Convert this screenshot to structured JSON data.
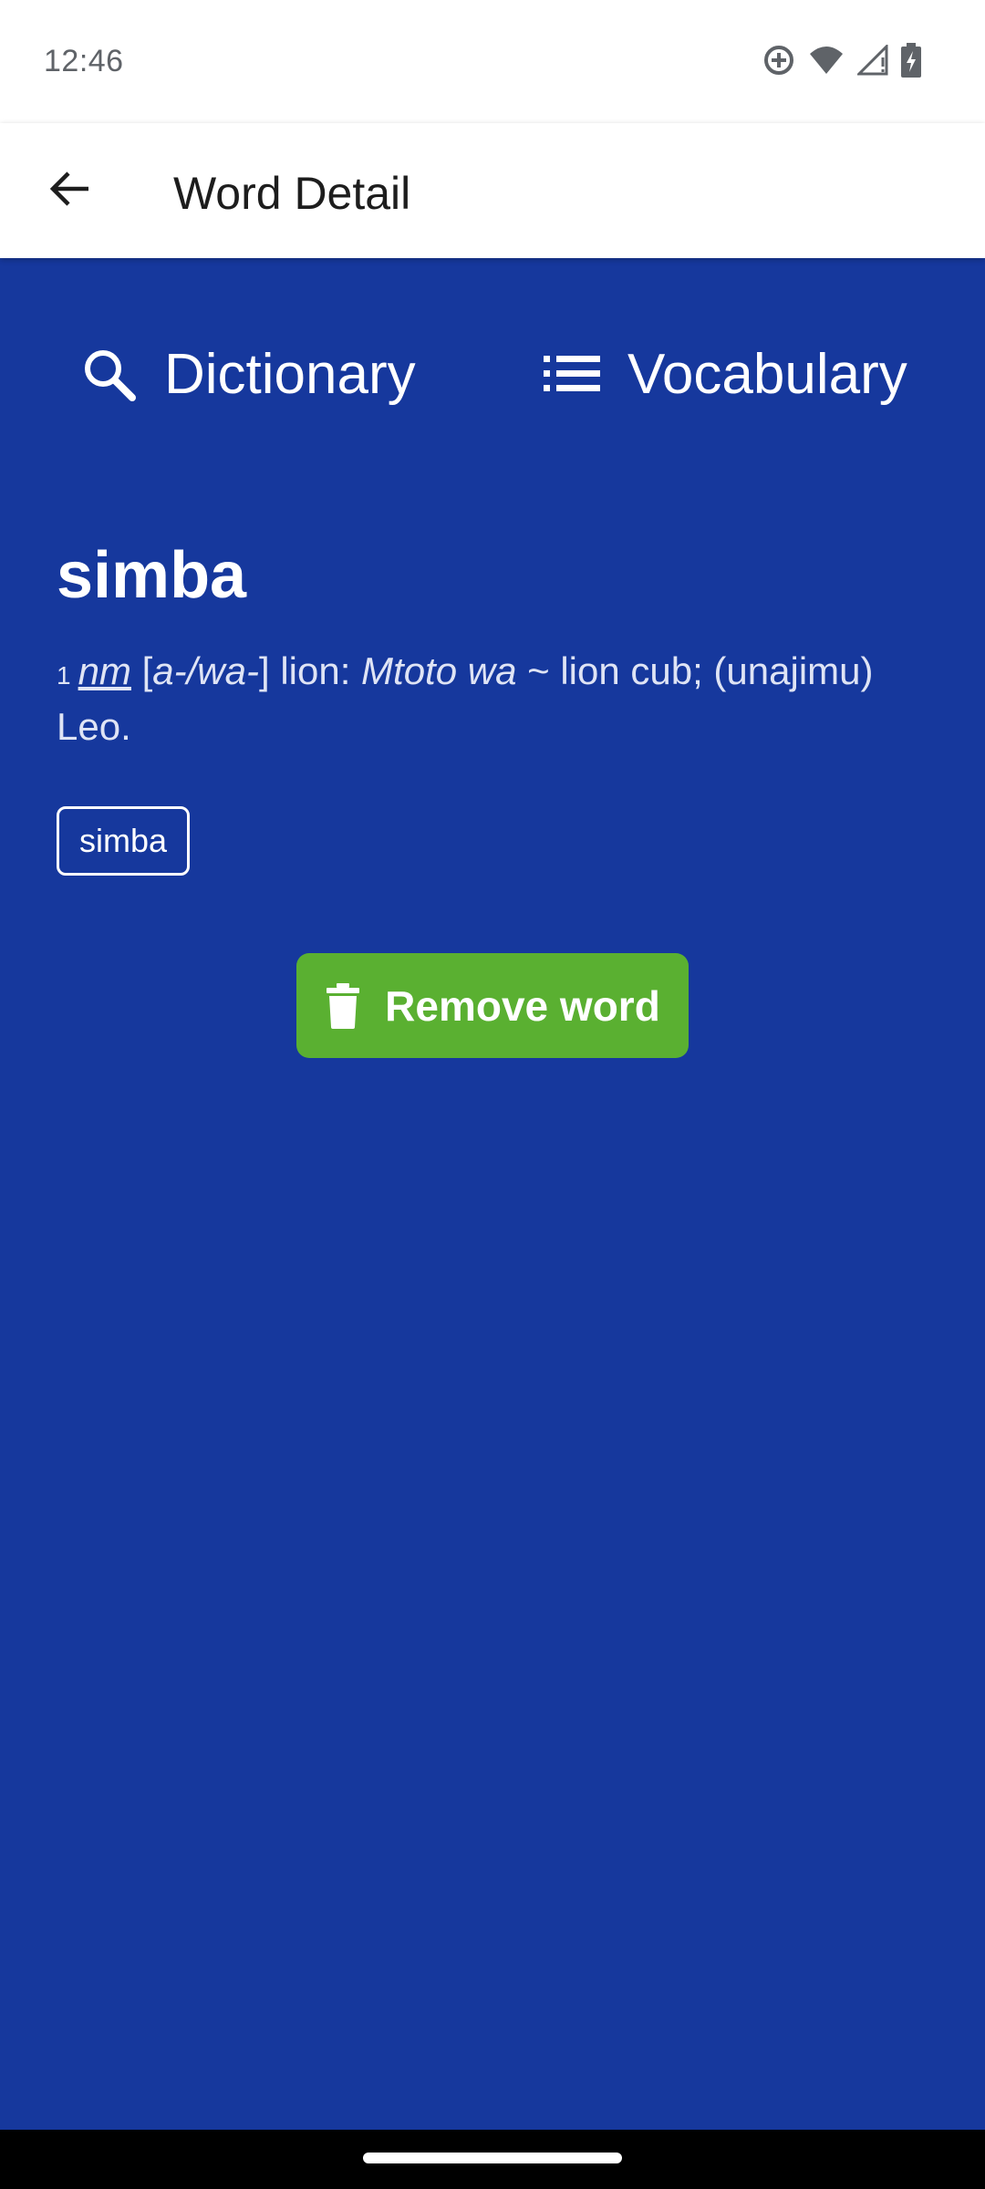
{
  "status_bar": {
    "time": "12:46",
    "icons": [
      "location-sync-icon",
      "wifi-icon",
      "signal-icon",
      "battery-charging-icon"
    ]
  },
  "app_bar": {
    "title": "Word Detail",
    "back_icon": "arrow-back-icon"
  },
  "tabs": [
    {
      "label": "Dictionary",
      "icon": "search-icon"
    },
    {
      "label": "Vocabulary",
      "icon": "list-icon"
    }
  ],
  "word": {
    "headword": "simba",
    "sense_number": "1",
    "part_of_speech": "nm",
    "noun_class": "[a-/wa-]",
    "gloss": " lion: ",
    "example_phrase": "Mtoto wa",
    "example_rest": " ~ lion cub; (unajimu) Leo.",
    "tag": "simba"
  },
  "actions": {
    "remove_label": "Remove word",
    "remove_icon": "trash-icon"
  },
  "colors": {
    "background": "#16389d",
    "remove_button": "#5ab031",
    "app_bar": "#ffffff"
  }
}
